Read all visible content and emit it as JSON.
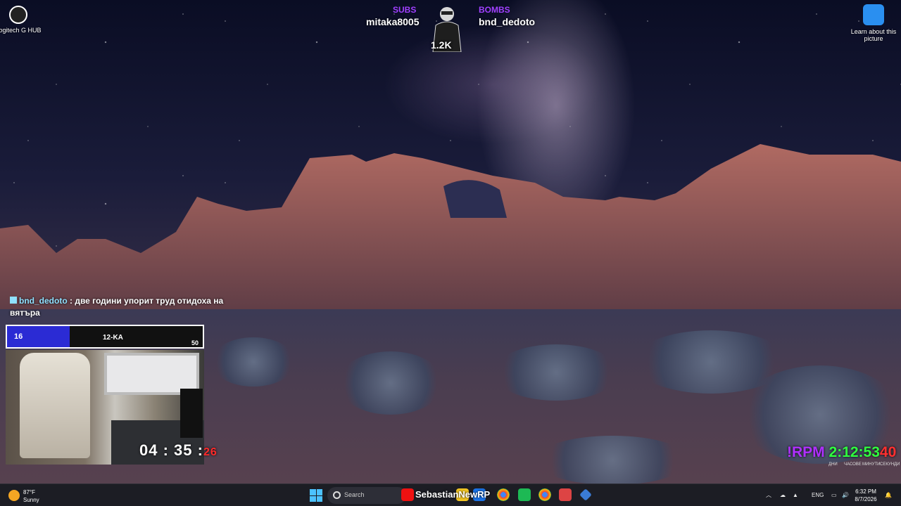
{
  "desktop_icons": [
    {
      "label": "Logitech G HUB",
      "icon": "logitech-g-hub-icon"
    },
    {
      "label": "Learn about this picture",
      "icon": "info-camera-icon"
    }
  ],
  "stream_overlay": {
    "left_tag": "SUBS",
    "left_user": "mitaka8005",
    "right_tag": "BOMBS",
    "right_user": "bnd_dedoto",
    "viewer_count": "1.2K"
  },
  "chat": {
    "user": "bnd_dedoto",
    "message": ": две години упорит труд отидоха на вятъра"
  },
  "goal": {
    "current": "16",
    "name": "12-KA",
    "max": "50",
    "progress": 0.32
  },
  "webcam_timer": {
    "main": "04 : 35 :",
    "seconds": "26"
  },
  "rpm_timer": {
    "label": "!RPM",
    "time": "2:12:53",
    "seconds": "40",
    "units": [
      "ДНИ",
      "ЧАСОВЕ",
      "МИНУТИ",
      "СЕКУНДИ"
    ]
  },
  "taskbar": {
    "weather_temp": "87°F",
    "weather_condition": "Sunny",
    "search_placeholder": "Search",
    "stream_title": "SebastianNewRP",
    "language": "ENG",
    "time": "6:32 PM",
    "date": "8/7/2026"
  },
  "colors": {
    "accent": "#4cc2ff",
    "goal_fill": "#2b2bd4",
    "rpm_label": "#b030ff",
    "rpm_time": "#30ff40",
    "red": "#ff2a2a"
  }
}
